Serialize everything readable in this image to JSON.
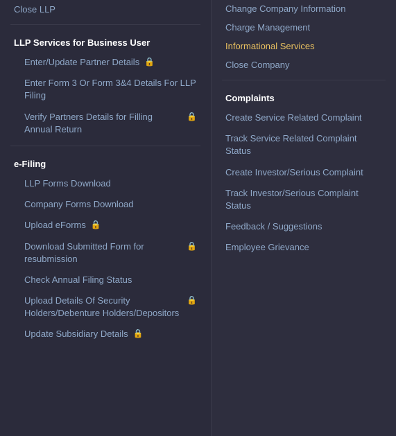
{
  "left": {
    "top_item": "Close LLP",
    "section1": {
      "header": "LLP Services for Business User",
      "items": [
        {
          "label": "Enter/Update Partner Details",
          "lock": true
        },
        {
          "label": "Enter Form 3 Or Form 3&4 Details For LLP Filing",
          "lock": false
        },
        {
          "label": "Verify Partners Details for Filling Annual Return",
          "lock": true
        }
      ]
    },
    "section2": {
      "header": "e-Filing",
      "items": [
        {
          "label": "LLP Forms Download",
          "lock": false
        },
        {
          "label": "Company Forms Download",
          "lock": false
        },
        {
          "label": "Upload eForms",
          "lock": true
        },
        {
          "label": "Download Submitted Form for resubmission",
          "lock": true
        },
        {
          "label": "Check Annual Filing Status",
          "lock": false
        },
        {
          "label": "Upload Details Of Security Holders/Debenture Holders/Depositors",
          "lock": true
        },
        {
          "label": "Update Subsidiary Details",
          "lock": true
        }
      ]
    }
  },
  "right": {
    "top_items": [
      {
        "label": "Change Company Information",
        "active": false
      },
      {
        "label": "Charge Management",
        "active": false
      },
      {
        "label": "Informational Services",
        "active": true
      },
      {
        "label": "Close Company",
        "active": false
      }
    ],
    "complaints_header": "Complaints",
    "complaints_items": [
      {
        "label": "Create Service Related Complaint",
        "active": false
      },
      {
        "label": "Track Service Related Complaint Status",
        "active": true
      },
      {
        "label": "Create Investor/Serious Complaint",
        "active": false
      },
      {
        "label": "Track Investor/Serious Complaint Status",
        "active": false
      },
      {
        "label": "Feedback / Suggestions",
        "active": false
      },
      {
        "label": "Employee Grievance",
        "active": false
      }
    ]
  },
  "icons": {
    "lock": "🔒"
  }
}
